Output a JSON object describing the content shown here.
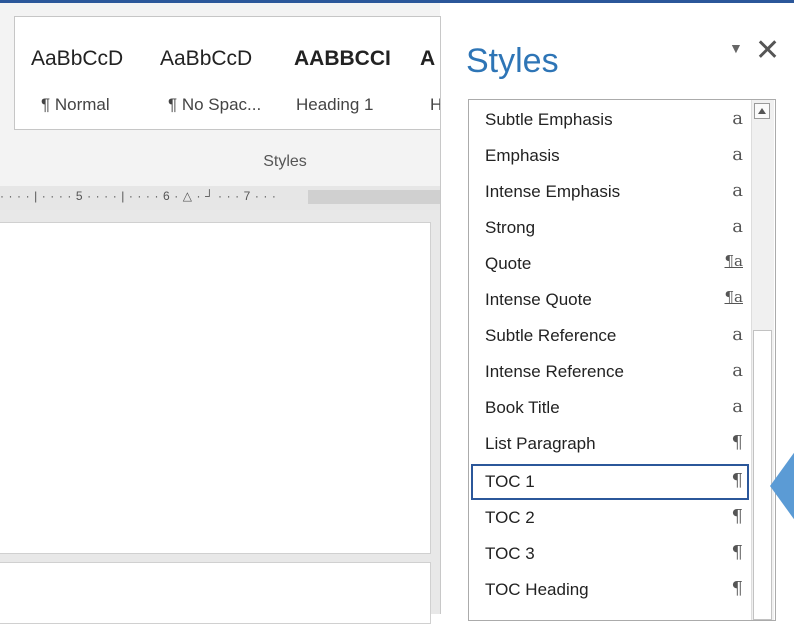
{
  "ribbon": {
    "styles": [
      {
        "preview": "AaBbCcD",
        "name": "¶ Normal",
        "bold": false,
        "caps": false
      },
      {
        "preview": "AaBbCcD",
        "name": "¶ No Spac...",
        "bold": false,
        "caps": false
      },
      {
        "preview": "AABBCCI",
        "name": "Heading 1",
        "bold": true,
        "caps": true
      },
      {
        "preview": "A",
        "name": "H",
        "bold": true,
        "caps": false
      }
    ],
    "group_label": "Styles"
  },
  "ruler": {
    "text": "· · · · | · · · · 5 · · · · | · · · · 6 · △ · ┘ · · · 7 · · ·"
  },
  "pane": {
    "title": "Styles",
    "dropdown_icon": "▼",
    "close_icon": "✕",
    "items": [
      {
        "label": "Subtle Emphasis",
        "icon": "a",
        "type": "char"
      },
      {
        "label": "Emphasis",
        "icon": "a",
        "type": "char"
      },
      {
        "label": "Intense Emphasis",
        "icon": "a",
        "type": "char"
      },
      {
        "label": "Strong",
        "icon": "a",
        "type": "char"
      },
      {
        "label": "Quote",
        "icon": "¶a",
        "type": "linked"
      },
      {
        "label": "Intense Quote",
        "icon": "¶a",
        "type": "linked"
      },
      {
        "label": "Subtle Reference",
        "icon": "a",
        "type": "char"
      },
      {
        "label": "Intense Reference",
        "icon": "a",
        "type": "char"
      },
      {
        "label": "Book Title",
        "icon": "a",
        "type": "char"
      },
      {
        "label": "List Paragraph",
        "icon": "¶",
        "type": "para"
      },
      {
        "label": "TOC 1",
        "icon": "¶",
        "type": "para",
        "selected": true
      },
      {
        "label": "TOC 2",
        "icon": "¶",
        "type": "para"
      },
      {
        "label": "TOC 3",
        "icon": "¶",
        "type": "para"
      },
      {
        "label": "TOC Heading",
        "icon": "¶",
        "type": "para"
      }
    ]
  },
  "colors": {
    "accent": "#2b579a",
    "title_blue": "#2e75b6",
    "callout": "#5b9bd5"
  }
}
